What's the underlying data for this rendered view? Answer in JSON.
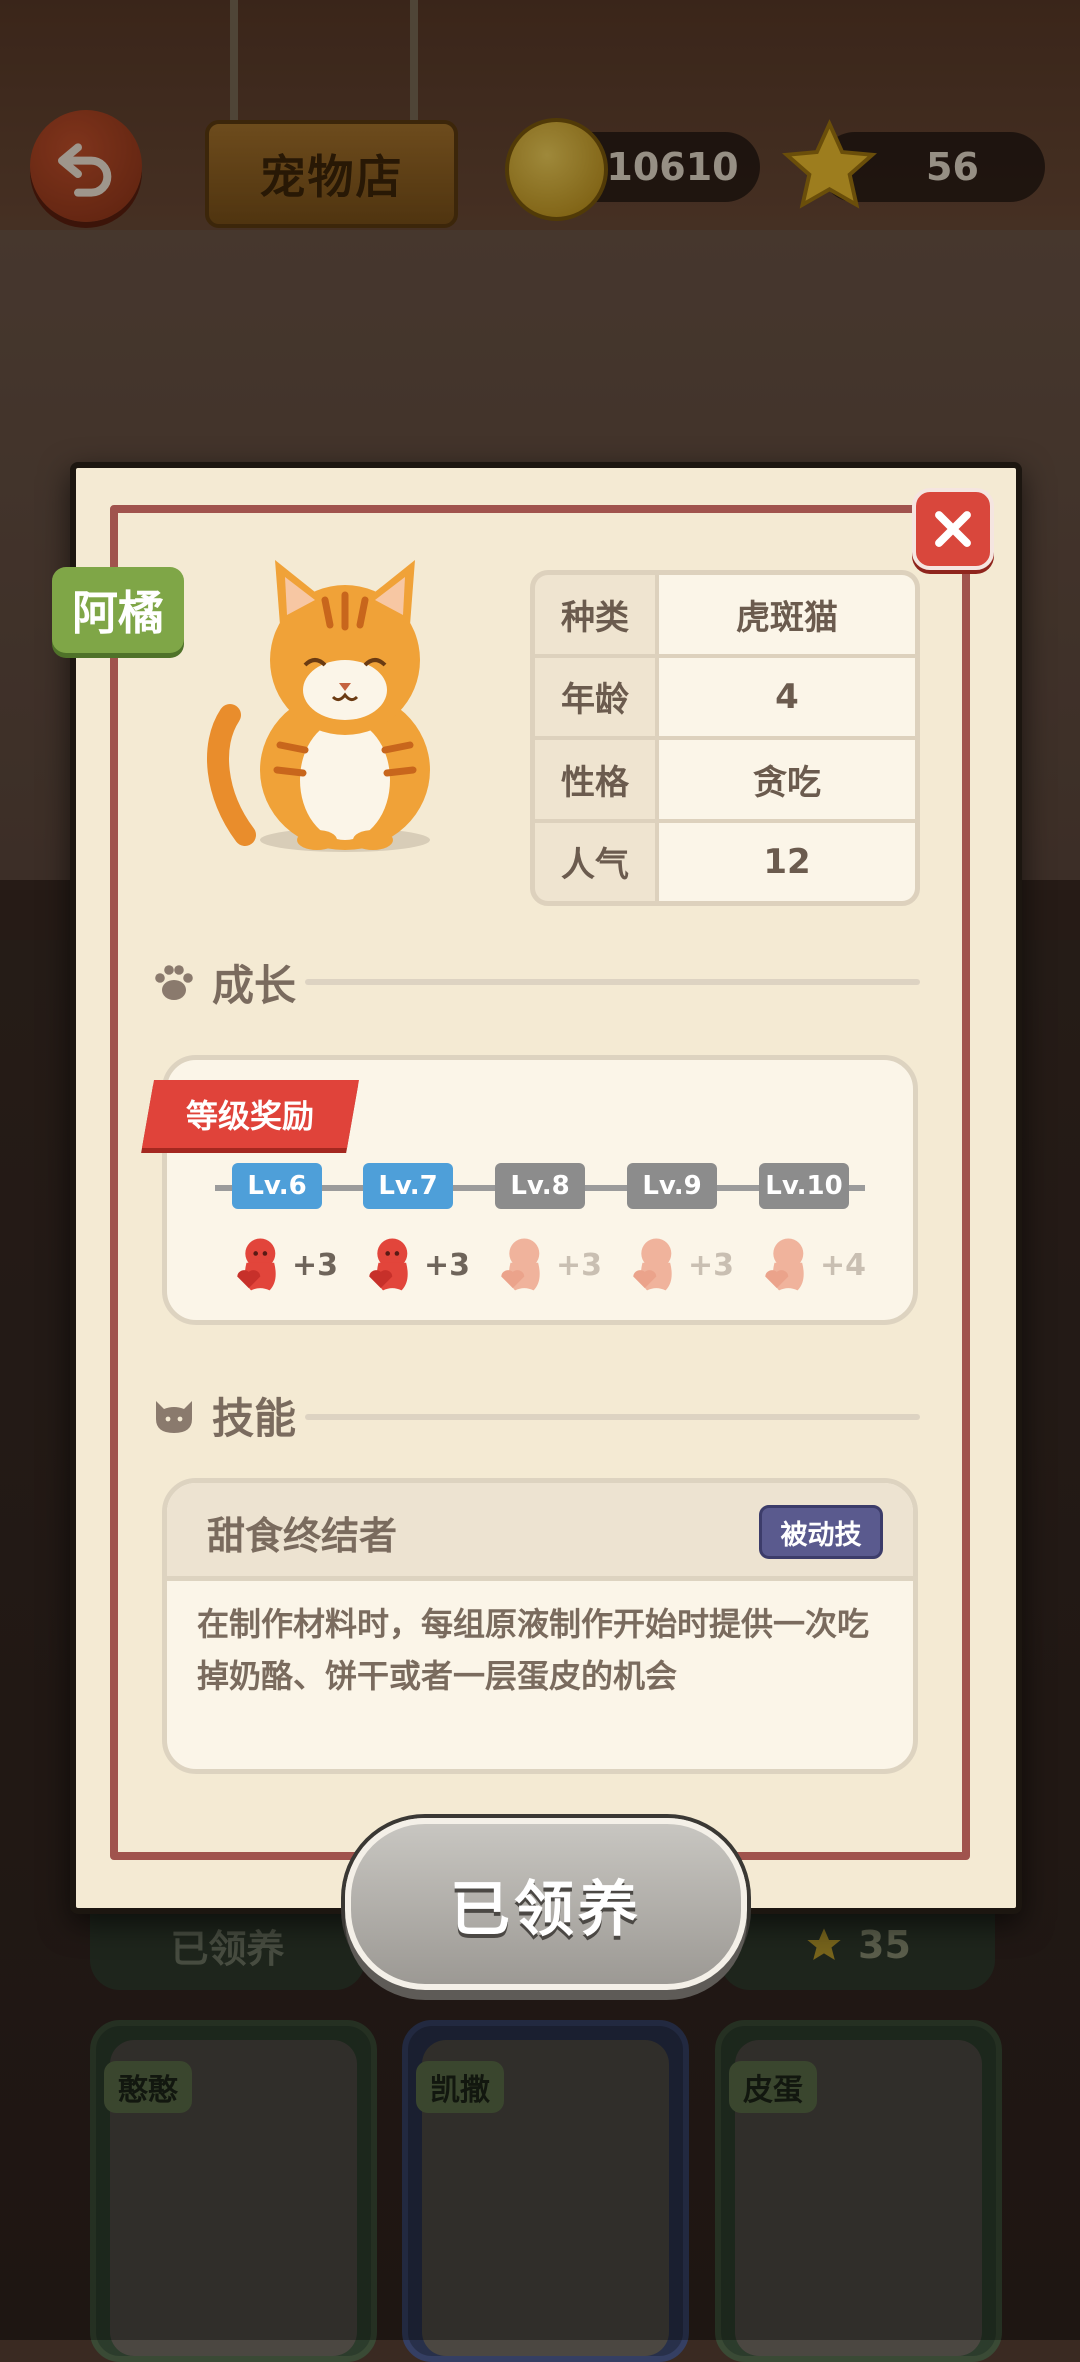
{
  "header": {
    "shop_title": "宠物店",
    "coins": "10610",
    "stars": "56"
  },
  "pet": {
    "name": "阿橘",
    "attributes": [
      {
        "key": "种类",
        "value": "虎斑猫"
      },
      {
        "key": "年龄",
        "value": "4"
      },
      {
        "key": "性格",
        "value": "贪吃"
      },
      {
        "key": "人气",
        "value": "12"
      }
    ]
  },
  "growth": {
    "section_title": "成长",
    "ribbon": "等级奖励",
    "levels": [
      {
        "label": "Lv.6",
        "reward": "+3",
        "unlocked": true
      },
      {
        "label": "Lv.7",
        "reward": "+3",
        "unlocked": true
      },
      {
        "label": "Lv.8",
        "reward": "+3",
        "unlocked": false
      },
      {
        "label": "Lv.9",
        "reward": "+3",
        "unlocked": false
      },
      {
        "label": "Lv.10",
        "reward": "+4",
        "unlocked": false
      }
    ]
  },
  "skill": {
    "section_title": "技能",
    "name": "甜食终结者",
    "badge": "被动技",
    "description": "在制作材料时，每组原液制作开始时提供一次吃掉奶酪、饼干或者一层蛋皮的机会"
  },
  "adopt_button": "已领养",
  "background_cards": {
    "left_strip": "已领养",
    "right_strip_stars": "35",
    "cards": [
      {
        "name": "憨憨"
      },
      {
        "name": "凯撒"
      },
      {
        "name": "皮蛋"
      }
    ]
  },
  "colors": {
    "dialog_bg": "#f4ead3",
    "frame": "#a0534d",
    "level_on": "#4e9fd9",
    "level_off": "#8c8c8c",
    "name_tag": "#7fa647",
    "ribbon": "#e0433a",
    "reward_active": "#e2453b",
    "reward_inactive": "#f0b39c"
  },
  "icons": {
    "back": "back-arrow-icon",
    "coin": "coin-icon",
    "star": "star-icon",
    "close": "close-icon",
    "growth": "paw-icon",
    "skill": "cat-face-icon",
    "reward": "heart-creature-icon"
  }
}
